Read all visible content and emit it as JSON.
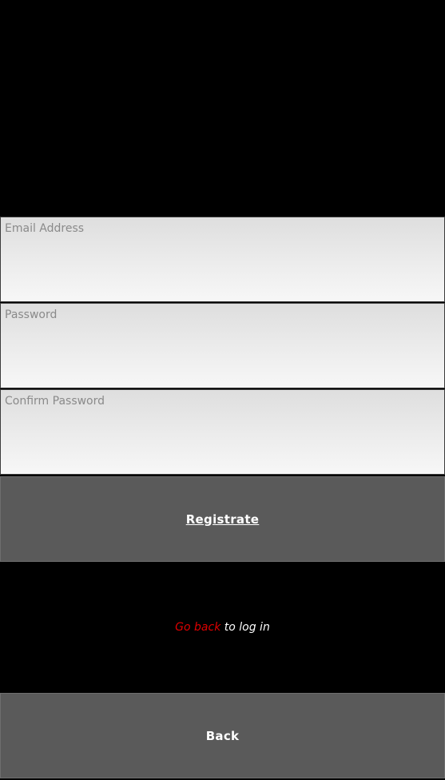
{
  "form": {
    "email": {
      "placeholder": "Email Address",
      "value": ""
    },
    "password": {
      "placeholder": "Password",
      "value": ""
    },
    "confirm_password": {
      "placeholder": "Confirm Password",
      "value": ""
    }
  },
  "buttons": {
    "register_label": "Registrate",
    "back_label": "Back"
  },
  "login_prompt": {
    "link_text": "Go back",
    "rest_text": " to log in"
  },
  "colors": {
    "background": "#000000",
    "button": "#5a5a5a",
    "link": "#e00000",
    "placeholder": "#8a8a8a"
  }
}
